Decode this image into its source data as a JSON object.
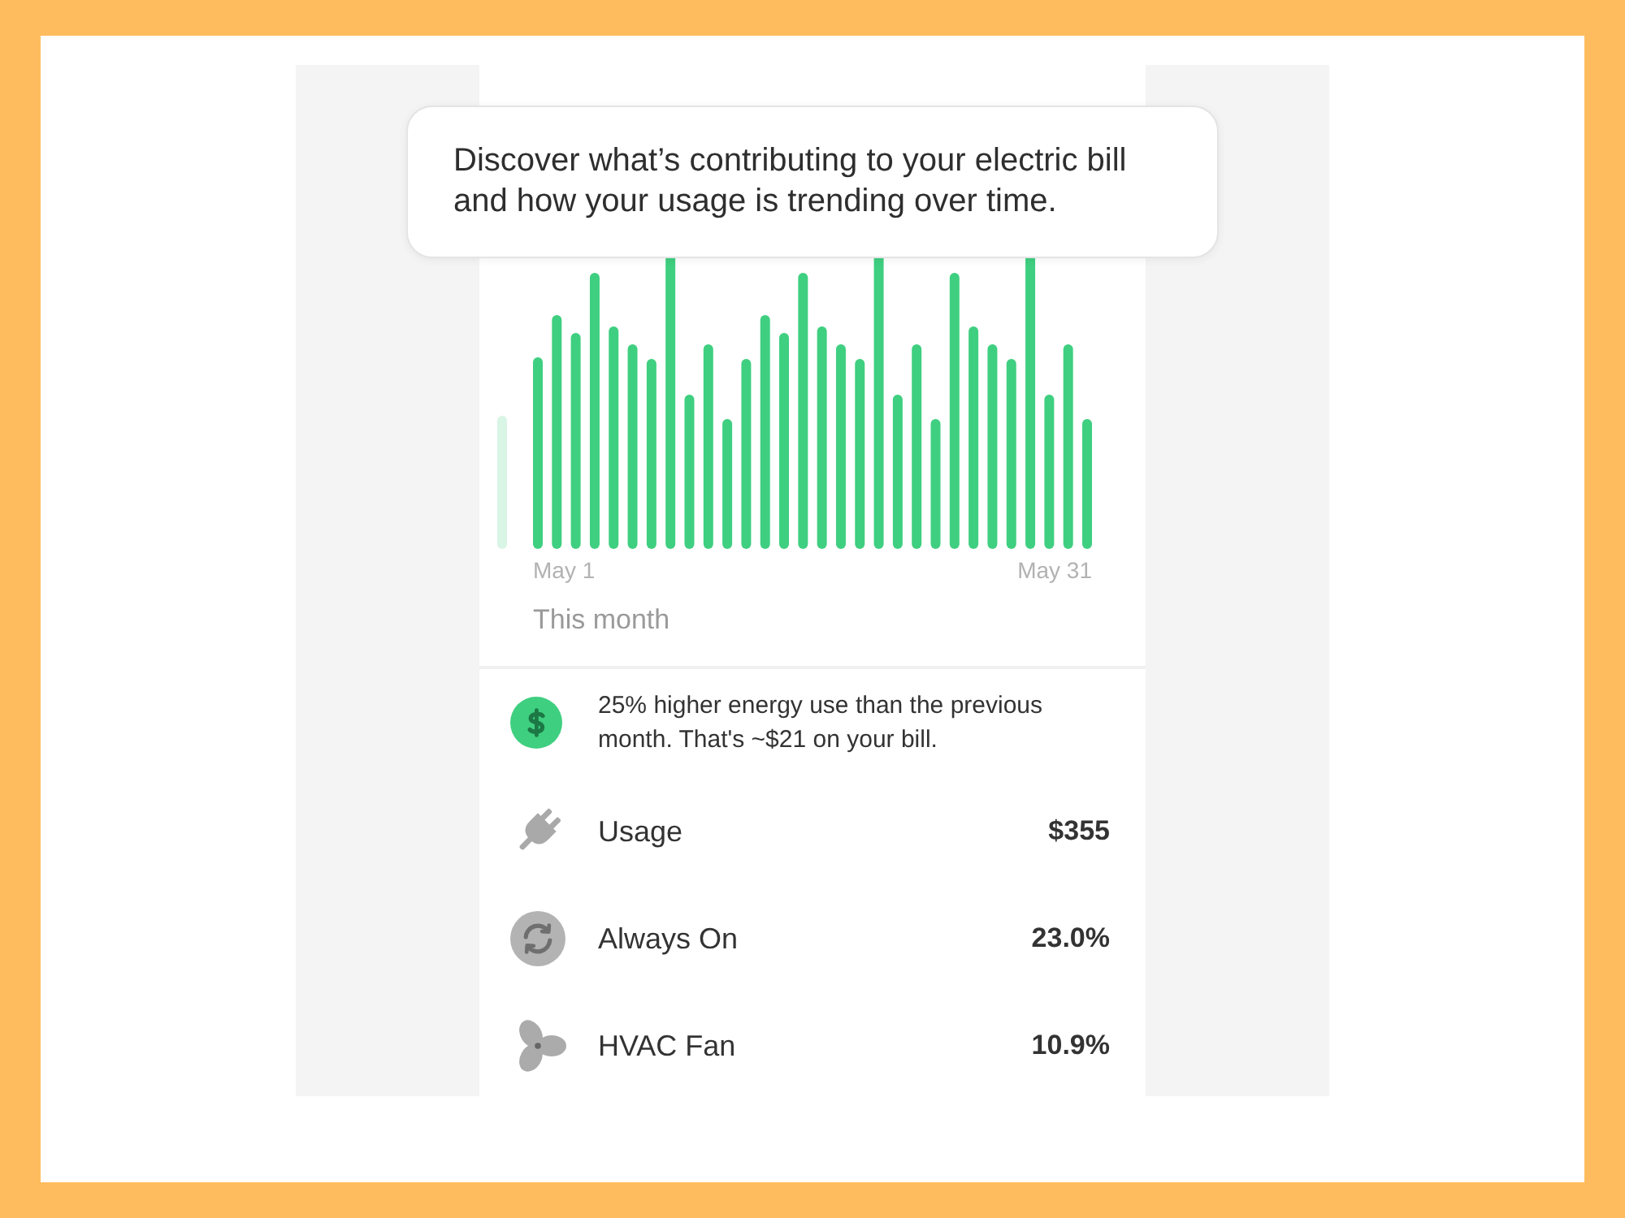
{
  "tooltip": {
    "text": "Discover what’s contributing to your electric bill and how your usage is trending over time."
  },
  "chart": {
    "start_label": "May 1",
    "end_label": "May 31",
    "period": "This month"
  },
  "insight": {
    "text": "25% higher energy use than the previous month. That's ~$21 on your bill."
  },
  "categories": [
    {
      "kind": "usage",
      "label": "Usage",
      "value": "$355"
    },
    {
      "kind": "always_on",
      "label": "Always On",
      "value": "23.0%"
    },
    {
      "kind": "fan",
      "label": "HVAC Fan",
      "value": "10.9%"
    }
  ]
}
